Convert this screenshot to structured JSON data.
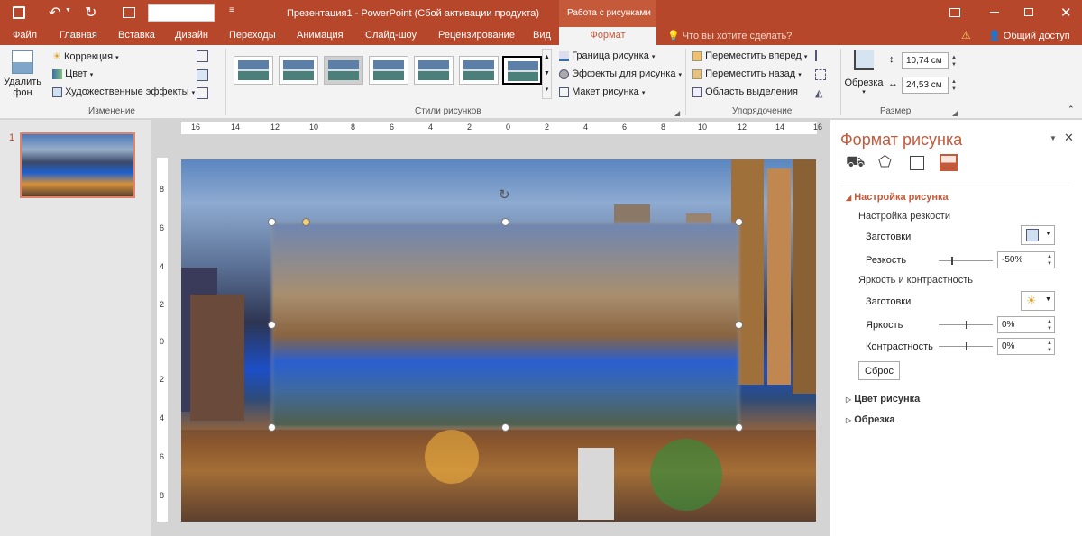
{
  "title_bar": {
    "title": "Презентация1 - PowerPoint (Сбой активации продукта)",
    "context_tab_group": "Работа с рисунками"
  },
  "tabs": [
    "Файл",
    "Главная",
    "Вставка",
    "Дизайн",
    "Переходы",
    "Анимация",
    "Слайд-шоу",
    "Рецензирование",
    "Вид",
    "Формат"
  ],
  "active_tab": "Формат",
  "tell_me": "Что вы хотите сделать?",
  "share": "Общий доступ",
  "ribbon": {
    "remove_bg": [
      "Удалить",
      "фон"
    ],
    "correction": "Коррекция",
    "color": "Цвет",
    "artistic": "Художественные эффекты",
    "group_change": "Изменение",
    "group_styles": "Стили рисунков",
    "border": "Граница рисунка",
    "effects": "Эффекты для рисунка",
    "layout": "Макет рисунка",
    "bring_forward": "Переместить вперед",
    "send_backward": "Переместить назад",
    "selection_pane": "Область выделения",
    "group_arrange": "Упорядочение",
    "crop": "Обрезка",
    "height": "10,74 см",
    "width": "24,53 см",
    "group_size": "Размер"
  },
  "slide_number": "1",
  "ruler_h": [
    "16",
    "14",
    "12",
    "10",
    "8",
    "6",
    "4",
    "2",
    "0",
    "2",
    "4",
    "6",
    "8",
    "10",
    "12",
    "14",
    "16"
  ],
  "ruler_v": [
    "8",
    "6",
    "4",
    "2",
    "0",
    "2",
    "4",
    "6",
    "8"
  ],
  "panel": {
    "title": "Формат рисунка",
    "section": "Настройка рисунка",
    "sharpness_header": "Настройка резкости",
    "presets": "Заготовки",
    "sharpness": "Резкость",
    "sharpness_value": "-50%",
    "bc_header": "Яркость и контрастность",
    "presets2": "Заготовки",
    "brightness": "Яркость",
    "brightness_value": "0%",
    "contrast": "Контрастность",
    "contrast_value": "0%",
    "reset": "Сброс",
    "color_section": "Цвет рисунка",
    "crop_section": "Обрезка"
  },
  "colors": {
    "accent": "#b7472a",
    "panel_title": "#c55a3b"
  }
}
